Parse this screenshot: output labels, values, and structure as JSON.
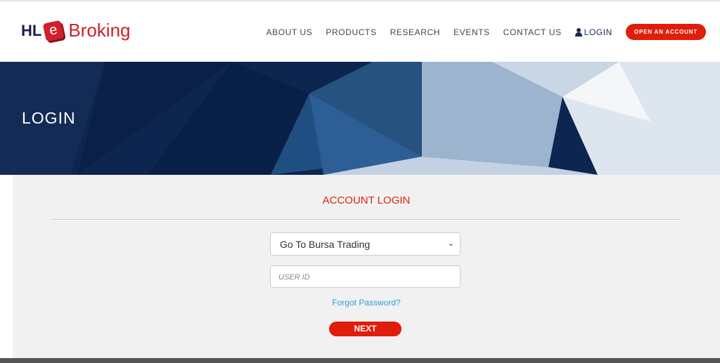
{
  "logo": {
    "hl": "HL",
    "e": "e",
    "broking": "Broking"
  },
  "nav": {
    "items": [
      "ABOUT US",
      "PRODUCTS",
      "RESEARCH",
      "EVENTS",
      "CONTACT US"
    ],
    "login": "LOGIN",
    "open_account": "OPEN AN ACCOUNT"
  },
  "banner": {
    "title": "LOGIN"
  },
  "form": {
    "title": "ACCOUNT LOGIN",
    "select_value": "Go To Bursa Trading",
    "userid_placeholder": "USER ID",
    "forgot": "Forgot Password?",
    "next": "NEXT"
  },
  "colors": {
    "accent": "#e01d0b",
    "navy": "#0f2a55",
    "link": "#2aa0d0"
  }
}
